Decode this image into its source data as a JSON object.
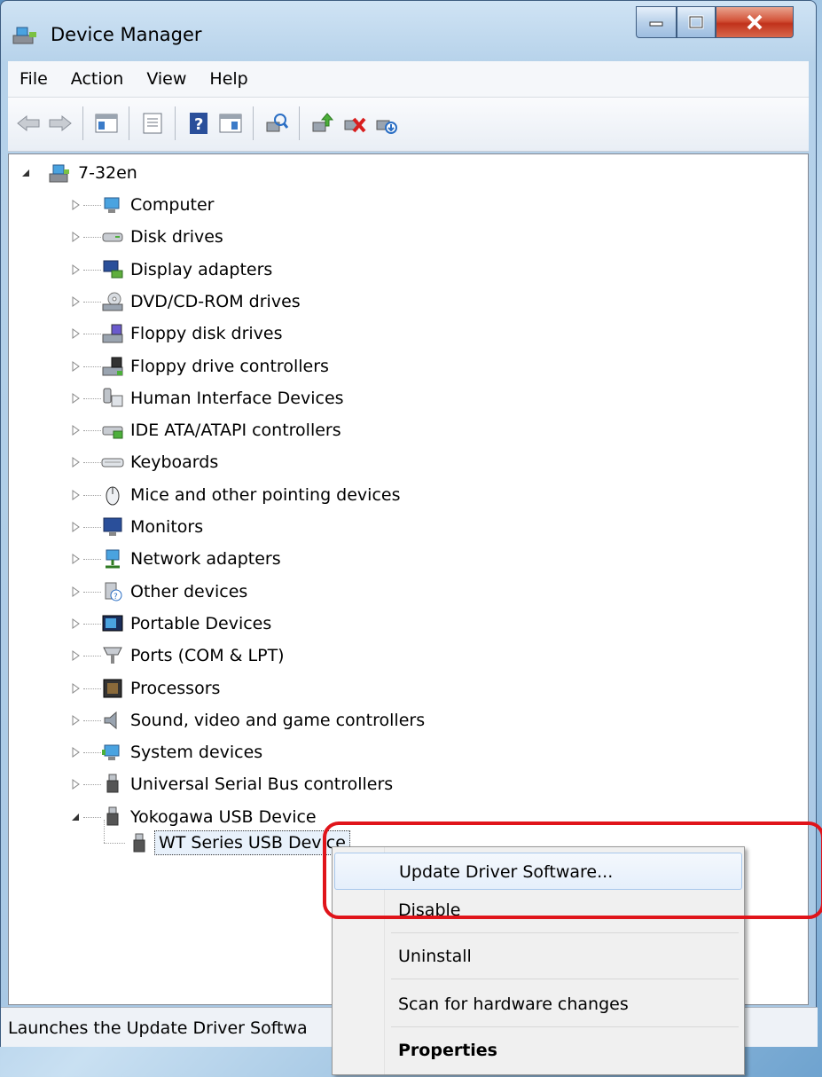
{
  "window": {
    "title": "Device Manager"
  },
  "menu": [
    "File",
    "Action",
    "View",
    "Help"
  ],
  "tree": {
    "root": "7-32en",
    "categories": [
      {
        "label": "Computer",
        "icon": "computer-icon"
      },
      {
        "label": "Disk drives",
        "icon": "disk-drive-icon"
      },
      {
        "label": "Display adapters",
        "icon": "display-adapter-icon"
      },
      {
        "label": "DVD/CD-ROM drives",
        "icon": "dvd-drive-icon"
      },
      {
        "label": "Floppy disk drives",
        "icon": "floppy-disk-icon"
      },
      {
        "label": "Floppy drive controllers",
        "icon": "floppy-controller-icon"
      },
      {
        "label": "Human Interface Devices",
        "icon": "hid-icon"
      },
      {
        "label": "IDE ATA/ATAPI controllers",
        "icon": "ide-controller-icon"
      },
      {
        "label": "Keyboards",
        "icon": "keyboard-icon"
      },
      {
        "label": "Mice and other pointing devices",
        "icon": "mouse-icon"
      },
      {
        "label": "Monitors",
        "icon": "monitor-icon"
      },
      {
        "label": "Network adapters",
        "icon": "network-adapter-icon"
      },
      {
        "label": "Other devices",
        "icon": "other-devices-icon"
      },
      {
        "label": "Portable Devices",
        "icon": "portable-device-icon"
      },
      {
        "label": "Ports (COM & LPT)",
        "icon": "port-icon"
      },
      {
        "label": "Processors",
        "icon": "processor-icon"
      },
      {
        "label": "Sound, video and game controllers",
        "icon": "speaker-icon"
      },
      {
        "label": "System devices",
        "icon": "system-device-icon"
      },
      {
        "label": "Universal Serial Bus controllers",
        "icon": "usb-icon"
      },
      {
        "label": "Yokogawa USB Device",
        "icon": "usb-icon"
      }
    ],
    "child": "WT Series USB Device"
  },
  "status": "Launches the Update Driver Softwa",
  "context_menu": {
    "items": [
      "Update Driver Software...",
      "Disable",
      "Uninstall",
      "Scan for hardware changes",
      "Properties"
    ]
  },
  "colors": {
    "highlight": "#e0141a",
    "close_button": "#c1321b"
  }
}
